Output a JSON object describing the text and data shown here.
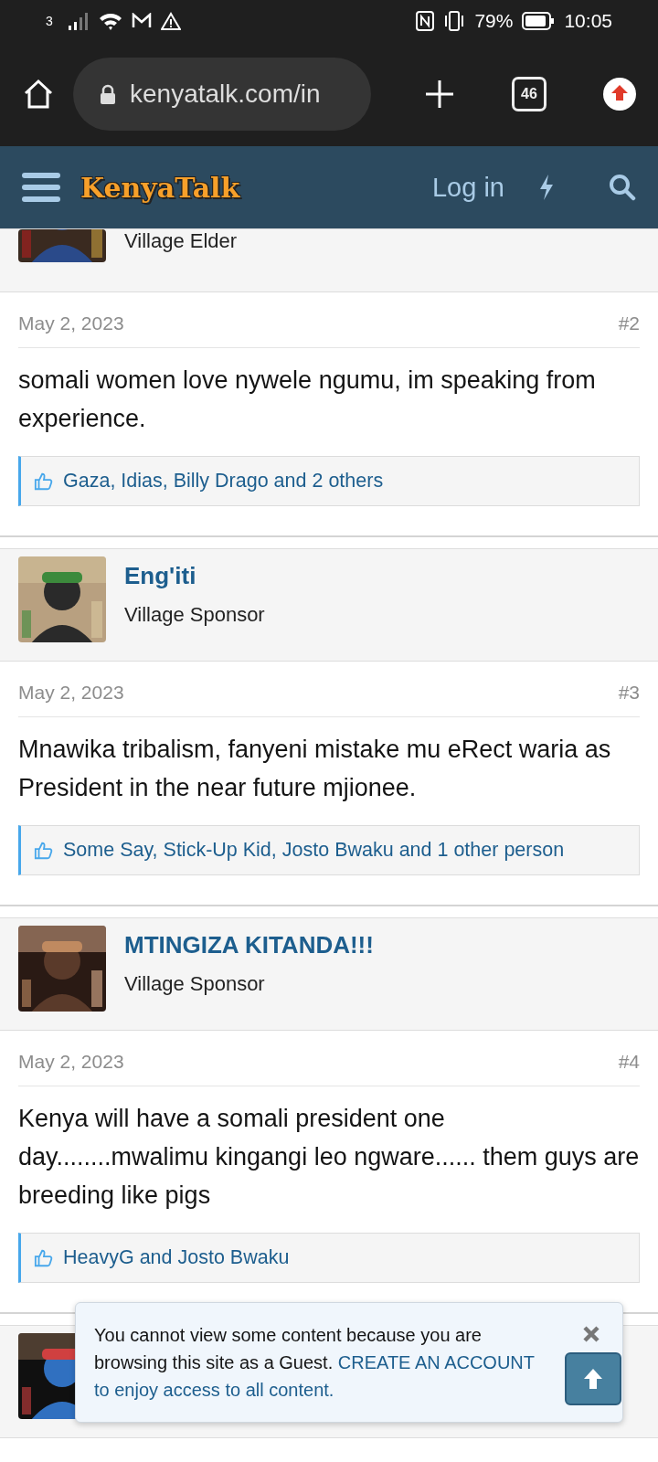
{
  "status_bar": {
    "carrier": "3",
    "battery": "79%",
    "time": "10:05"
  },
  "browser": {
    "url": "kenyatalk.com/in",
    "tab_count": "46"
  },
  "site_header": {
    "logo": "KenyaTalk",
    "login": "Log in"
  },
  "posts": [
    {
      "user": {
        "title": "Village Elder"
      },
      "avatar_cut": true,
      "date": "May 2, 2023",
      "number": "#2",
      "body": "somali women love nywele ngumu, im speaking from experience.",
      "likes": "Gaza, Idias, Billy Drago and 2 others"
    },
    {
      "user": {
        "name": "Eng'iti",
        "title": "Village Sponsor"
      },
      "date": "May 2, 2023",
      "number": "#3",
      "body": "Mnawika tribalism, fanyeni mistake mu eRect waria as President in the near future mjionee.",
      "likes": "Some Say, Stick-Up Kid, Josto Bwaku and 1 other person"
    },
    {
      "user": {
        "name": "MTINGIZA KITANDA!!!",
        "title": "Village Sponsor"
      },
      "date": "May 2, 2023",
      "number": "#4",
      "body": "Kenya will have a somali president one day........mwalimu kingangi leo ngware...... them guys are breeding like pigs",
      "likes": "HeavyG and Josto Bwaku"
    },
    {
      "kind": "picture"
    }
  ],
  "notice": {
    "text": "You cannot view some content because you are browsing this site as a Guest.",
    "link_lines": [
      "CREATE AN ACCOUNT",
      "to enjoy access to all content."
    ]
  }
}
